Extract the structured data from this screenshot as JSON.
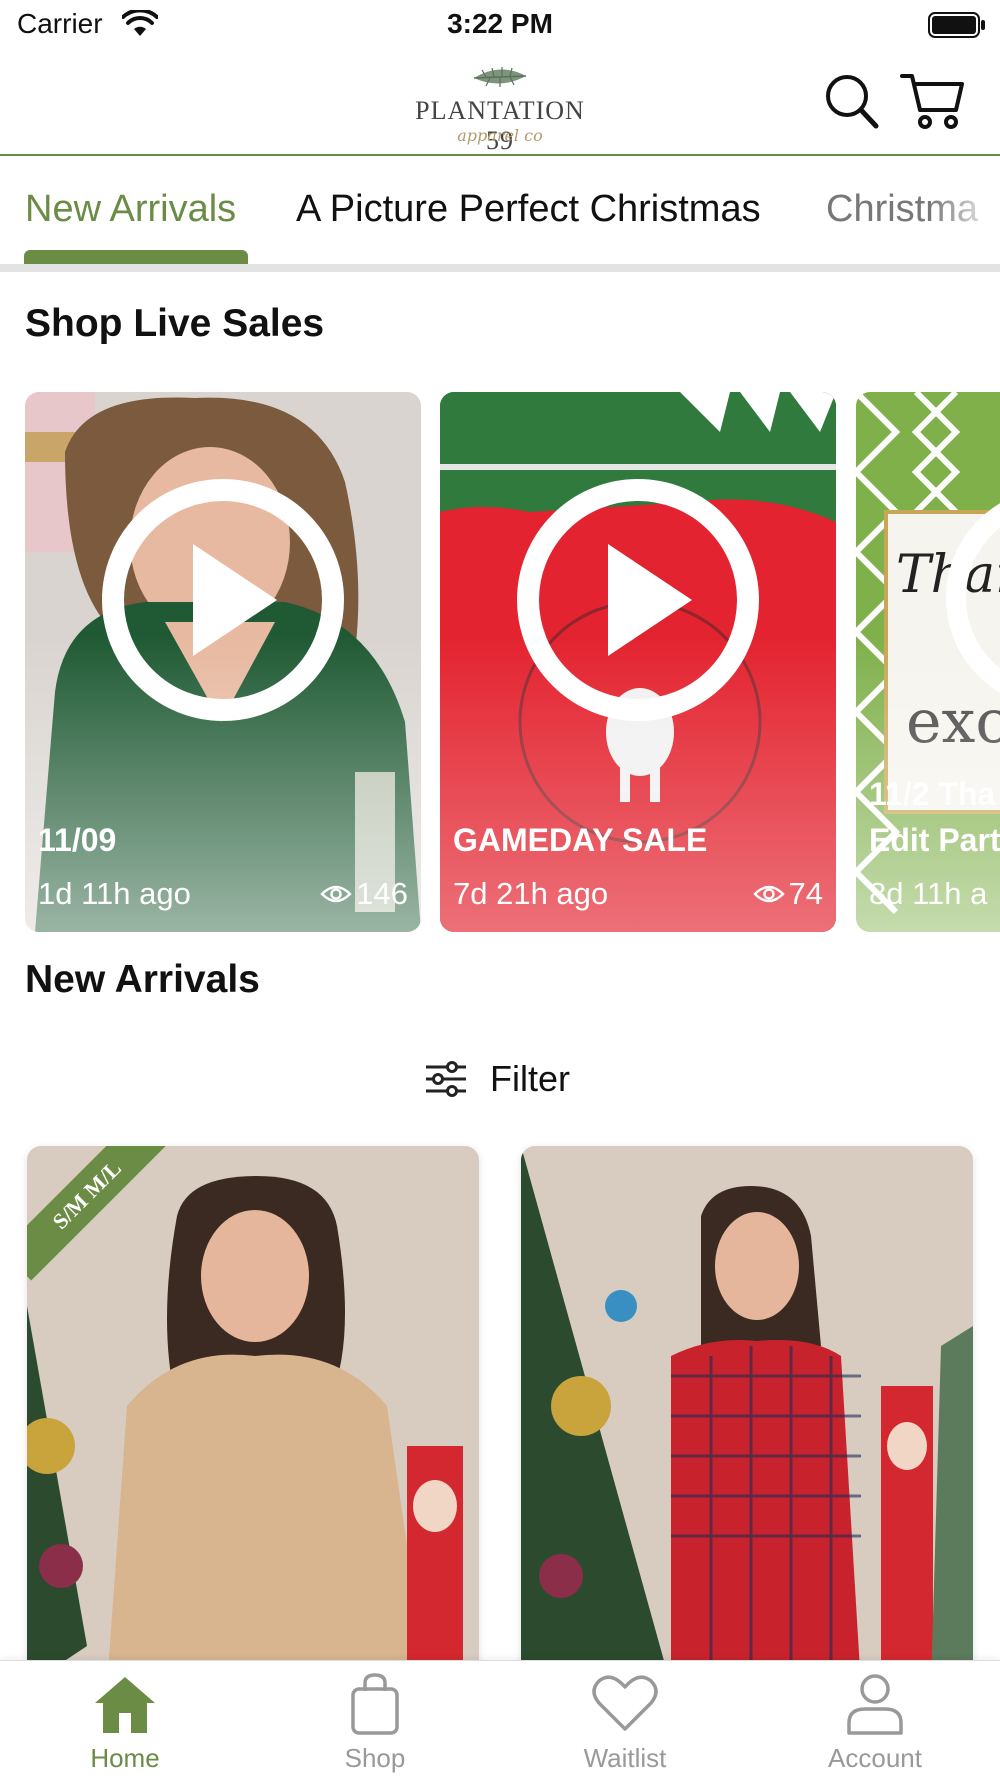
{
  "status_bar": {
    "carrier": "Carrier",
    "time": "3:22 PM"
  },
  "header": {
    "logo_name": "PLANTATION 59",
    "logo_sub": "apparel co"
  },
  "tabs": [
    {
      "label": "New Arrivals",
      "active": true
    },
    {
      "label": "A Picture Perfect Christmas",
      "active": false
    },
    {
      "label": "Christma",
      "active": false
    }
  ],
  "live_sales": {
    "title": "Shop Live Sales",
    "cards": [
      {
        "title": "11/09",
        "time": "1d 11h ago",
        "views": "146"
      },
      {
        "title": "GAMEDAY SALE",
        "time": "7d 21h ago",
        "views": "74"
      },
      {
        "title": "Edit Part",
        "subtitle": "11/2 Tha",
        "time": "8d 11h a"
      }
    ]
  },
  "new_arrivals": {
    "title": "New Arrivals",
    "filter_label": "Filter",
    "products": [
      {
        "badge": "S/M M/L"
      },
      {
        "badge": ""
      }
    ]
  },
  "bottom_nav": [
    {
      "label": "Home",
      "icon": "home-icon",
      "active": true
    },
    {
      "label": "Shop",
      "icon": "bag-icon",
      "active": false
    },
    {
      "label": "Waitlist",
      "icon": "heart-icon",
      "active": false
    },
    {
      "label": "Account",
      "icon": "person-icon",
      "active": false
    }
  ],
  "colors": {
    "brand_green": "#6b8c45",
    "inactive_gray": "#999999",
    "tab_rule": "#e3e3e3"
  }
}
